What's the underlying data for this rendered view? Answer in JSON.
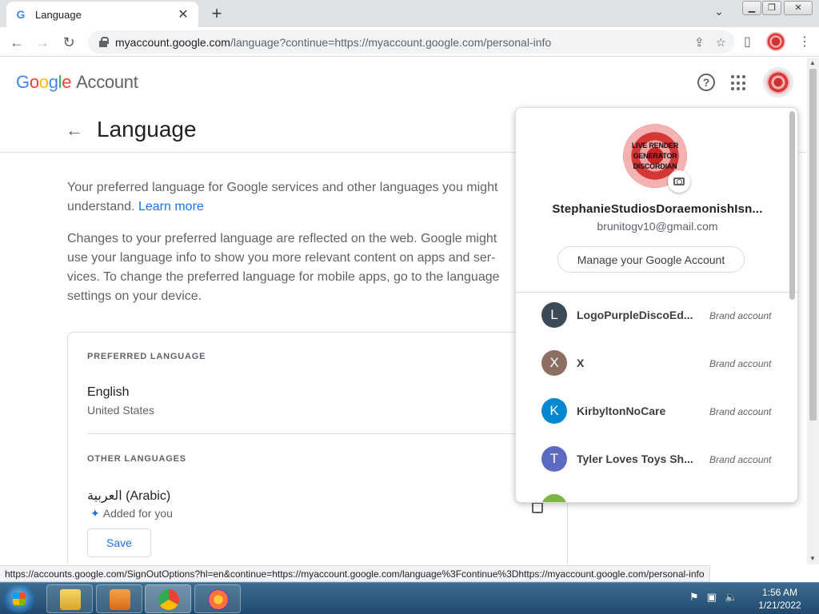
{
  "browser": {
    "tab_title": "Language",
    "tab_close": "✕",
    "new_tab": "+",
    "url_host": "myaccount.google.com",
    "url_path": "/language?continue=https://myaccount.google.com/personal-info"
  },
  "header": {
    "logo_letters": [
      "G",
      "o",
      "o",
      "g",
      "l",
      "e"
    ],
    "account_label": "Account"
  },
  "page": {
    "title": "Language",
    "intro": "Your preferred language for Google services and other languages you might understand.",
    "learn_more": "Learn more",
    "changes_text": "Changes to your preferred language are reflected on the web. Google might use your language info to show you more relevant content on apps and ser­vices. To change the preferred language for mobile apps, go to the language settings on your device."
  },
  "card": {
    "preferred_label": "PREFERRED LANGUAGE",
    "preferred_name": "English",
    "preferred_region": "United States",
    "other_label": "OTHER LANGUAGES",
    "other_name": "العربية (Arabic)",
    "other_note": "Added for you",
    "save_label": "Save"
  },
  "popup": {
    "avatar_text": [
      "LIVE RENDER",
      "GENERATOR",
      "DISCORDIAN"
    ],
    "name": "StephanieStudiosDoraemonishIsn...",
    "email": "brunitogv10@gmail.com",
    "manage_label": "Manage your Google Account",
    "accounts": [
      {
        "initial": "L",
        "name": "LogoPurpleDiscoEd...",
        "tag": "Brand account",
        "color": "#3c4a57"
      },
      {
        "initial": "X",
        "name": "X",
        "tag": "Brand account",
        "color": "#8d6e63"
      },
      {
        "initial": "K",
        "name": "KirbyltonNoCare",
        "tag": "Brand account",
        "color": "#0288d1"
      },
      {
        "initial": "T",
        "name": "Tyler Loves Toys Sh...",
        "tag": "Brand account",
        "color": "#5c6bc0"
      }
    ]
  },
  "statusbar": {
    "link": "https://accounts.google.com/SignOutOptions?hl=en&continue=https://myaccount.google.com/language%3Fcontinue%3Dhttps://myaccount.google.com/personal-info"
  },
  "taskbar": {
    "time": "1:56 AM",
    "date": "1/21/2022"
  }
}
